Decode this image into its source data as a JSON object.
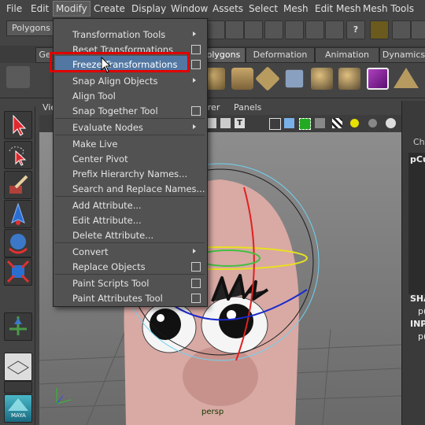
{
  "menubar": {
    "items": [
      "File",
      "Edit",
      "Modify",
      "Create",
      "Display",
      "Window",
      "Assets",
      "Select",
      "Mesh",
      "Edit Mesh",
      "Mesh Tools"
    ],
    "active": "Modify"
  },
  "statusline": {
    "mode": "Polygons"
  },
  "shelf": {
    "tabs": [
      "Ge",
      "olygons",
      "Deformation",
      "Animation",
      "Dynamics"
    ],
    "selected": "olygons"
  },
  "viewport": {
    "menu": [
      "Vie",
      "erer",
      "Panels"
    ],
    "camera_label": "persp",
    "channel_box_partial": {
      "header": "Cha",
      "object": "pCu",
      "shapes": "SHA",
      "shape_obj": "p(",
      "inputs": "INP",
      "input_obj": "p("
    }
  },
  "dropdown": {
    "items": [
      {
        "label": "Transformation Tools",
        "submenu": true,
        "option_box": false
      },
      {
        "label": "Reset Transformations",
        "submenu": false,
        "option_box": true
      },
      {
        "label": "Freeze Transformations",
        "submenu": false,
        "option_box": true,
        "highlighted": true
      },
      {
        "label": "Snap Align Objects",
        "submenu": true,
        "option_box": false
      },
      {
        "label": "Align Tool",
        "submenu": false,
        "option_box": false
      },
      {
        "label": "Snap Together Tool",
        "submenu": false,
        "option_box": true
      },
      {
        "label": "Evaluate Nodes",
        "submenu": true,
        "option_box": false
      },
      {
        "label": "Make Live",
        "submenu": false,
        "option_box": false
      },
      {
        "label": "Center Pivot",
        "submenu": false,
        "option_box": false
      },
      {
        "label": "Prefix Hierarchy Names...",
        "submenu": false,
        "option_box": false
      },
      {
        "label": "Search and Replace Names...",
        "submenu": false,
        "option_box": false
      },
      {
        "label": "Add Attribute...",
        "submenu": false,
        "option_box": false
      },
      {
        "label": "Edit Attribute...",
        "submenu": false,
        "option_box": false
      },
      {
        "label": "Delete Attribute...",
        "submenu": false,
        "option_box": false
      },
      {
        "label": "Convert",
        "submenu": true,
        "option_box": false
      },
      {
        "label": "Replace Objects",
        "submenu": false,
        "option_box": true
      },
      {
        "label": "Paint Scripts Tool",
        "submenu": false,
        "option_box": true
      },
      {
        "label": "Paint Attributes Tool",
        "submenu": false,
        "option_box": true
      }
    ]
  },
  "colors": {
    "highlight": "#5277a3",
    "callout": "#e00000",
    "head": "#d9a9a4"
  },
  "toolbox": {
    "logo_text": "MAYA"
  }
}
